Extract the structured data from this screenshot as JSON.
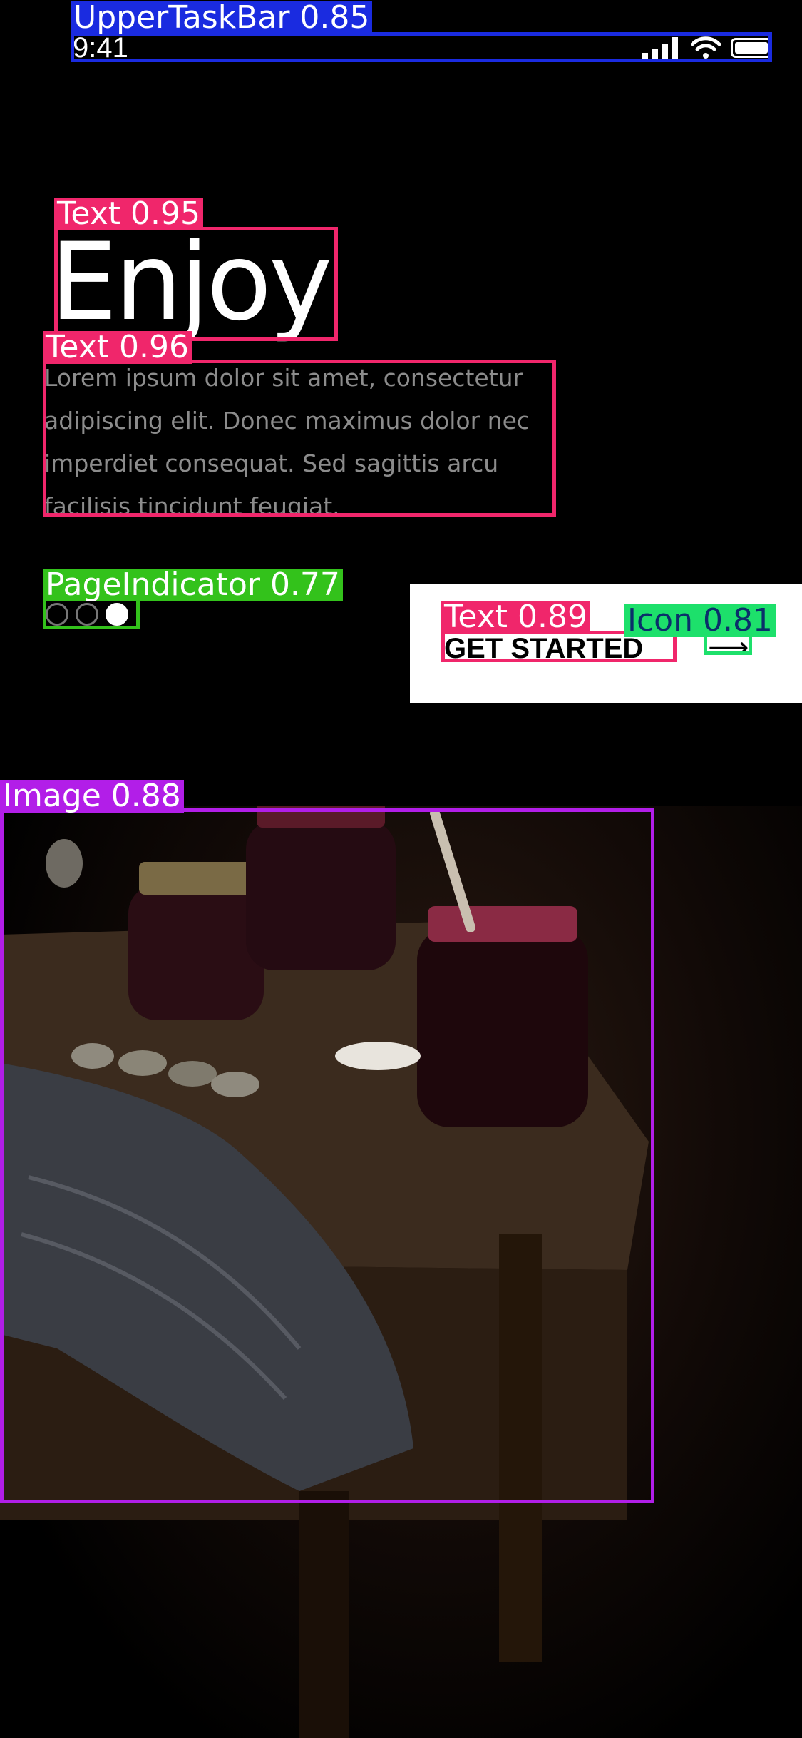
{
  "status_bar": {
    "time": "9:41",
    "icons": [
      "signal-icon",
      "wifi-icon",
      "battery-icon"
    ]
  },
  "onboarding": {
    "title": "Enjoy",
    "body": "Lorem ipsum dolor sit amet, consectetur adipiscing elit. Donec maximus dolor nec imperdiet consequat. Sed sagittis arcu facilisis tincidunt feugiat.",
    "pager": {
      "count": 3,
      "active_index": 2
    },
    "cta": {
      "label": "GET STARTED",
      "icon": "arrow-right-icon"
    }
  },
  "detections": [
    {
      "label": "UpperTaskBar",
      "score": "0.85",
      "display": "UpperTaskBar 0.85",
      "color": "#1a2be0"
    },
    {
      "label": "Text",
      "score": "0.95",
      "display": "Text 0.95",
      "color": "#f0266b"
    },
    {
      "label": "Text",
      "score": "0.96",
      "display": "Text 0.96",
      "color": "#f0266b"
    },
    {
      "label": "PageIndicator",
      "score": "0.77",
      "display": "PageIndicator 0.77",
      "color": "#33c21b"
    },
    {
      "label": "Text",
      "score": "0.89",
      "display": "Text 0.89",
      "color": "#f0266b"
    },
    {
      "label": "Icon",
      "score": "0.81",
      "display": "Icon 0.81",
      "color": "#1de06b"
    },
    {
      "label": "Image",
      "score": "0.88",
      "display": "Image 0.88",
      "color": "#b21ee8"
    }
  ],
  "colors": {
    "background": "#000000",
    "cta_background": "#ffffff",
    "body_text": "#8c8c8c"
  }
}
